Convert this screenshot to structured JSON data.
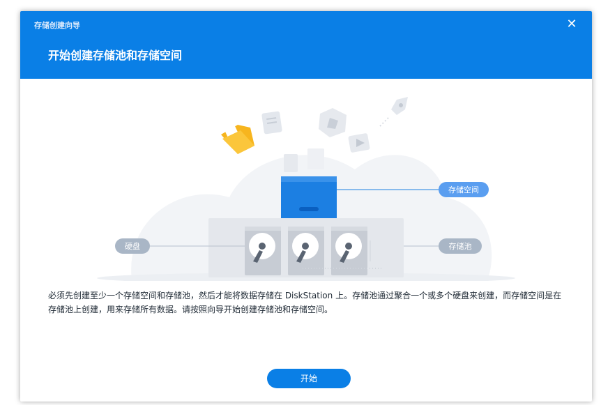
{
  "window": {
    "title": "存储创建向导",
    "close_icon": "close-icon"
  },
  "header": {
    "title": "开始创建存储池和存储空间",
    "background_color": "#0a7fe6"
  },
  "illustration": {
    "labels": {
      "volume": "存储空间",
      "pool": "存储池",
      "disk": "硬盘"
    },
    "icons": [
      "folder-icon",
      "document-icon",
      "photo-icon",
      "video-icon",
      "rocket-icon",
      "volume-box-icon",
      "hard-disk-icon"
    ]
  },
  "main": {
    "description": "必须先创建至少一个存储空间和存储池，然后才能将数据存储在 DiskStation 上。存储池通过聚合一个或多个硬盘来创建，而存储空间是在存储池上创建，用来存储所有数据。请按照向导开始创建存储池和存储空间。"
  },
  "footer": {
    "start_label": "开始",
    "accent_color": "#0a7fe6"
  }
}
